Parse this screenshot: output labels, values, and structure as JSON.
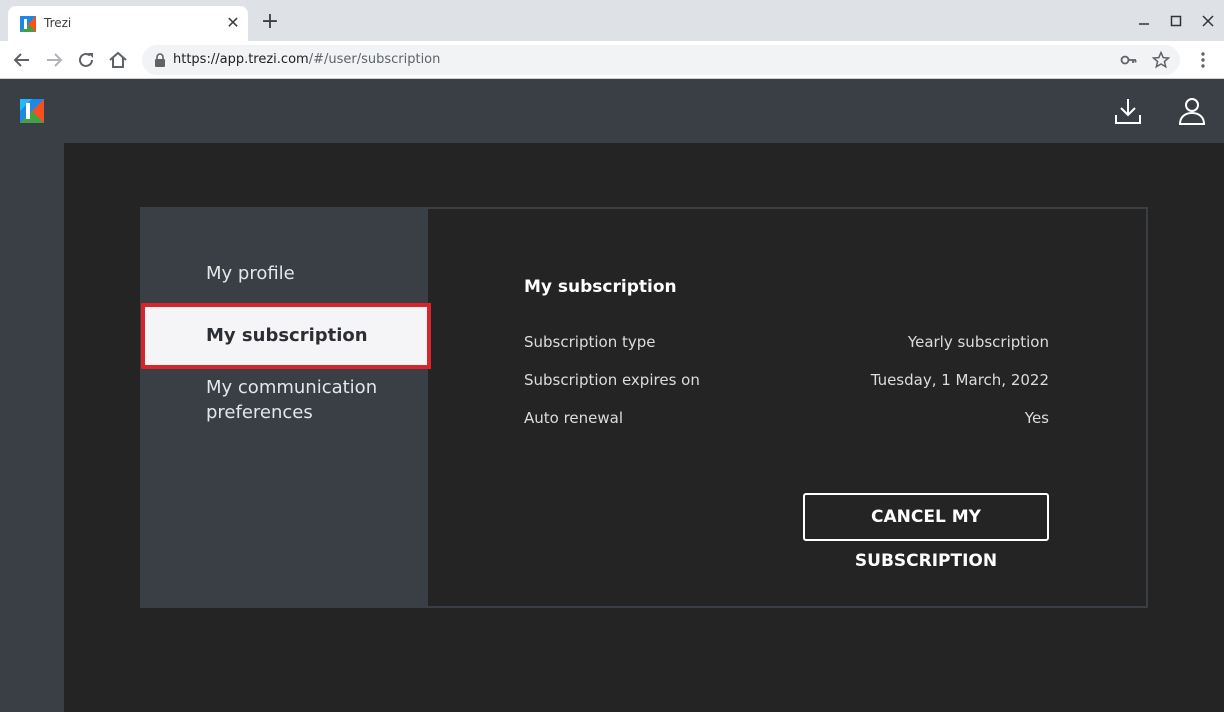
{
  "browser": {
    "tab_title": "Trezi",
    "tab_close": "✕",
    "new_tab": "+",
    "url_host": "https://app.trezi.com",
    "url_path": "/#/user/subscription"
  },
  "sidebar": {
    "items": [
      {
        "label": "My profile"
      },
      {
        "label": "My subscription",
        "active": true
      },
      {
        "label": "My communication preferences"
      }
    ]
  },
  "subscription": {
    "title": "My subscription",
    "rows": [
      {
        "key": "Subscription type",
        "value": "Yearly subscription"
      },
      {
        "key": "Subscription expires on",
        "value": "Tuesday, 1 March, 2022"
      },
      {
        "key": "Auto renewal",
        "value": "Yes"
      }
    ],
    "cancel_label": "CANCEL MY SUBSCRIPTION"
  },
  "colors": {
    "header": "#3a3f46",
    "background": "#242424",
    "highlight_border": "#d9242b"
  },
  "icons": [
    "trezi-logo-icon",
    "download-icon",
    "user-icon",
    "lock-icon",
    "key-icon",
    "star-icon"
  ]
}
